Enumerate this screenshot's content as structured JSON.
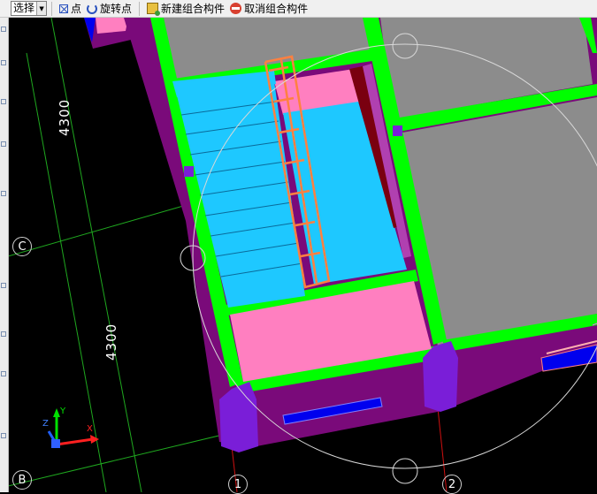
{
  "toolbar": {
    "select_value": "选择",
    "point_label": "点",
    "rotate_point_label": "旋转点",
    "new_group_label": "新建组合构件",
    "cancel_group_label": "取消组合构件"
  },
  "canvas": {
    "dimensions": [
      "4300",
      "4300"
    ],
    "axes": {
      "row_c": "C",
      "row_b": "B",
      "col_1": "1",
      "col_2": "2"
    },
    "gizmo_axes": [
      "X",
      "Y",
      "Z"
    ]
  },
  "colors": {
    "background": "#000000",
    "wall": "#7a0a7a",
    "beam": "#00ff00",
    "stair": "#1ec8ff",
    "slab": "#ff7fc0",
    "column": "#7a1ed8",
    "floor_grey": "#8c8c8c",
    "handrail": "#ff8040",
    "opening": "#0000ee"
  }
}
